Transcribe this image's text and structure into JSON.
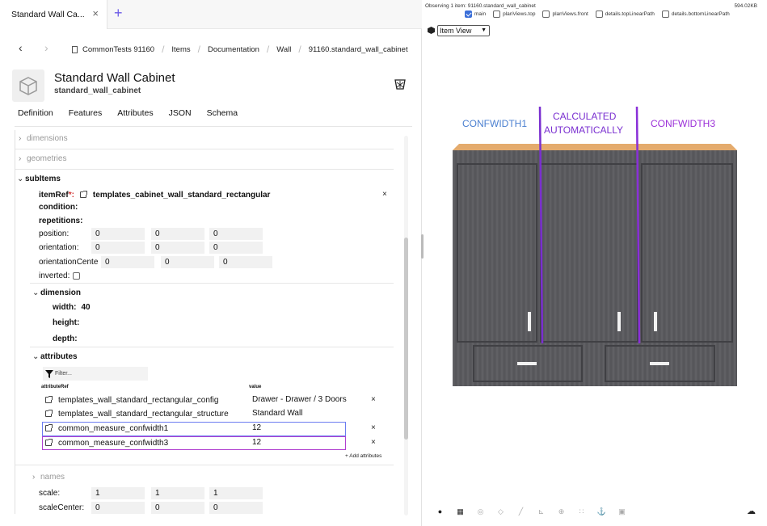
{
  "tab": {
    "title": "Standard Wall Ca...",
    "close": "×",
    "add": "+"
  },
  "breadcrumb": {
    "back": "‹",
    "forward": "›",
    "items": [
      "CommonTests 91160",
      "Items",
      "Documentation",
      "Wall",
      "91160.standard_wall_cabinet"
    ],
    "sep": "/"
  },
  "header": {
    "title": "Standard Wall Cabinet",
    "subtitle": "standard_wall_cabinet"
  },
  "subtabs": [
    "Definition",
    "Features",
    "Attributes",
    "JSON",
    "Schema"
  ],
  "tree": {
    "dimensions": "dimensions",
    "geometries": "geometries",
    "subitems": "subItems",
    "itemref_label": "itemRef",
    "itemref_req": "*:",
    "itemref_value": "templates_cabinet_wall_standard_rectangular",
    "condition": "condition:",
    "repetitions": "repetitions:",
    "position": "position:",
    "position_vals": [
      "0",
      "0",
      "0"
    ],
    "orientation": "orientation:",
    "orientation_vals": [
      "0",
      "0",
      "0"
    ],
    "orientation_center": "orientationCente",
    "orientation_center_vals": [
      "0",
      "0",
      "0"
    ],
    "inverted": "inverted:",
    "dimension": "dimension",
    "width_label": "width:",
    "width_value": "40",
    "height_label": "height:",
    "depth_label": "depth:",
    "attributes": "attributes",
    "filter_placeholder": "Filter...",
    "col_attributeref": "attributeRef",
    "col_value": "value",
    "attr_rows": [
      {
        "ref": "templates_wall_standard_rectangular_config",
        "value": "Drawer - Drawer / 3 Doors"
      },
      {
        "ref": "templates_wall_standard_rectangular_structure",
        "value": "Standard Wall"
      },
      {
        "ref": "common_measure_confwidth1",
        "value": "12"
      },
      {
        "ref": "common_measure_confwidth3",
        "value": "12"
      }
    ],
    "add_attributes": "+ Add attributes",
    "names": "names",
    "scale": "scale:",
    "scale_vals": [
      "1",
      "1",
      "1"
    ],
    "scale_center": "scaleCenter:",
    "scale_center_vals": [
      "0",
      "0",
      "0"
    ],
    "remove": "×"
  },
  "viewer": {
    "observing": "Observing 1 item: 91160.standard_wall_cabinet",
    "size": "594.02KB",
    "layers": [
      {
        "label": "main",
        "checked": true
      },
      {
        "label": "planViews.top",
        "checked": false
      },
      {
        "label": "planViews.front",
        "checked": false
      },
      {
        "label": "details.topLinearPath",
        "checked": false
      },
      {
        "label": "details.bottomLinearPath",
        "checked": false
      }
    ],
    "view_mode": "Item View",
    "annotations": {
      "confwidth1": "CONFWIDTH1",
      "calc_line1": "CALCULATED",
      "calc_line2": "AUTOMATICALLY",
      "confwidth3": "CONFWIDTH3"
    },
    "colors": {
      "confwidth1": "#4a7fd0",
      "calculated": "#7a2fd0",
      "confwidth3": "#9b30d8",
      "cabinet_body": "#5b5b5f",
      "cabinet_top": "#e2a86a"
    }
  }
}
